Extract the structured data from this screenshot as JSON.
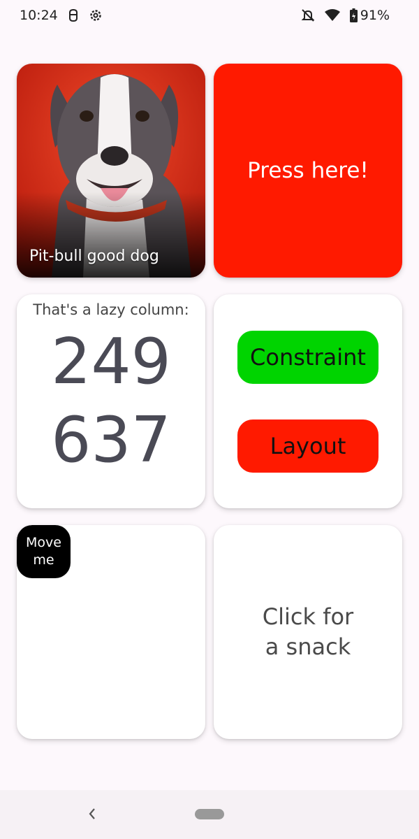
{
  "status_bar": {
    "time": "10:24",
    "battery": "91%",
    "icons": [
      "android-debug-icon",
      "settings-icon",
      "do-not-disturb-icon",
      "wifi-icon",
      "battery-icon"
    ]
  },
  "cards": {
    "dog": {
      "caption": "Pit-bull good dog"
    },
    "press": {
      "label": "Press here!",
      "color": "#ff1a00"
    },
    "lazy": {
      "title": "That's a lazy column:",
      "numbers": [
        "249",
        "637"
      ]
    },
    "constraint": {
      "button1": "Constraint",
      "button2": "Layout",
      "green": "#00d400",
      "red": "#ff1a00"
    },
    "move": {
      "line1": "Move",
      "line2": "me"
    },
    "snack": {
      "line1": "Click for",
      "line2": "a snack"
    }
  },
  "nav": {
    "icons": [
      "back-icon",
      "home-pill-icon"
    ]
  }
}
